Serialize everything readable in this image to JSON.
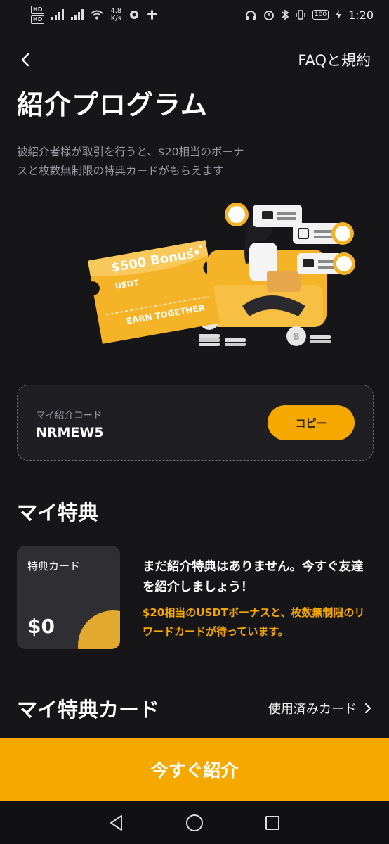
{
  "status_bar": {
    "network_speed_value": "4.8",
    "network_speed_unit": "K/s",
    "battery": "100",
    "time": "1:20"
  },
  "header": {
    "faq_label": "FAQと規約",
    "title": "紹介プログラム",
    "description": "被紹介者様が取引を行うと、$20相当のボーナスと枚数無制限の特典カードがもらえます"
  },
  "hero": {
    "ticket_amount": "$500 Bonus",
    "ticket_currency": "USDT",
    "ticket_tagline": "EARN TOGETHER"
  },
  "referral": {
    "label": "マイ紹介コード",
    "code": "NRMEW5",
    "copy_label": "コピー"
  },
  "my_benefits": {
    "title": "マイ特典",
    "card_label": "特典カード",
    "card_value": "$0",
    "empty_title": "まだ紹介特典はありません。今すぐ友達を紹介しましょう！",
    "empty_subtitle": "$20相当のUSDTボーナスと、枚数無制限のリワードカードが待っています。"
  },
  "my_cards": {
    "title": "マイ特典カード",
    "used_cards_label": "使用済みカード"
  },
  "cta": {
    "label": "今すぐ紹介"
  },
  "colors": {
    "accent": "#f5a900",
    "background": "#161619",
    "card": "#2f2f33",
    "muted_text": "#9a9aa2"
  },
  "icons": [
    "back-icon",
    "chevron-right-icon",
    "nav-back-icon",
    "nav-home-icon",
    "nav-recents-icon"
  ]
}
